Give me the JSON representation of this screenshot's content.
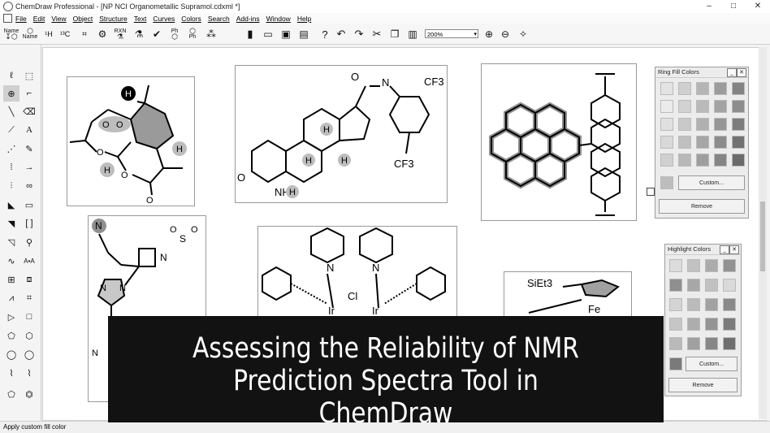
{
  "window": {
    "title": "ChemDraw Professional - [NP NCI Organometallic Supramol.cdxml *]",
    "min": "–",
    "max": "□",
    "close": "✕"
  },
  "menu": [
    "File",
    "Edit",
    "View",
    "Object",
    "Structure",
    "Text",
    "Curves",
    "Colors",
    "Search",
    "Add-ins",
    "Window",
    "Help"
  ],
  "toolbar": {
    "zoom": "200%",
    "name_label": "Name",
    "name_label2": "Name",
    "rxn_label": "RXN",
    "ph_label": "Ph",
    "ph_label2": "Ph"
  },
  "molecules": {
    "steroid": {
      "cf3_top": "CF3",
      "cf3_bottom": "CF3",
      "o_left": "O",
      "o_top": "O",
      "nh": "N",
      "h_top": "H",
      "h1": "H",
      "h2": "H",
      "h3": "H",
      "h4": "H",
      "nh_label": "NH"
    },
    "artemisinin": {
      "o1": "O",
      "o2": "O",
      "o3": "O",
      "o4": "O",
      "o5": "O",
      "h1": "H",
      "h2": "H",
      "h3": "H"
    },
    "sulfonyl": {
      "n1": "N",
      "n2": "N",
      "n3": "N",
      "n4": "N",
      "n5": "N",
      "s": "S",
      "o1": "O",
      "o2": "O"
    },
    "iridium": {
      "n1": "N",
      "n2": "N",
      "cl": "Cl",
      "ir1": "Ir",
      "ir2": "Ir"
    },
    "ferrocene": {
      "siet": "SiEt3",
      "fe": "Fe"
    }
  },
  "ring_fill_panel": {
    "title": "Ring Fill Colors",
    "custom": "Custom...",
    "remove": "Remove",
    "colors": [
      "#d6d6d6",
      "#bdbdbd",
      "#a9a9a9",
      "#8f8f8f",
      "#7a7a7a"
    ]
  },
  "highlight_panel": {
    "title": "Highlight Colors",
    "custom": "Custom...",
    "remove": "Remove",
    "colors": [
      "#d0d0d0",
      "#b2b2b2",
      "#999999",
      "#7f7f7f",
      "#666666"
    ]
  },
  "status": "Apply custom fill color",
  "banner": {
    "line1": "Assessing the Reliability of NMR",
    "line2": "Prediction Spectra Tool in",
    "line3": "ChemDraw"
  }
}
